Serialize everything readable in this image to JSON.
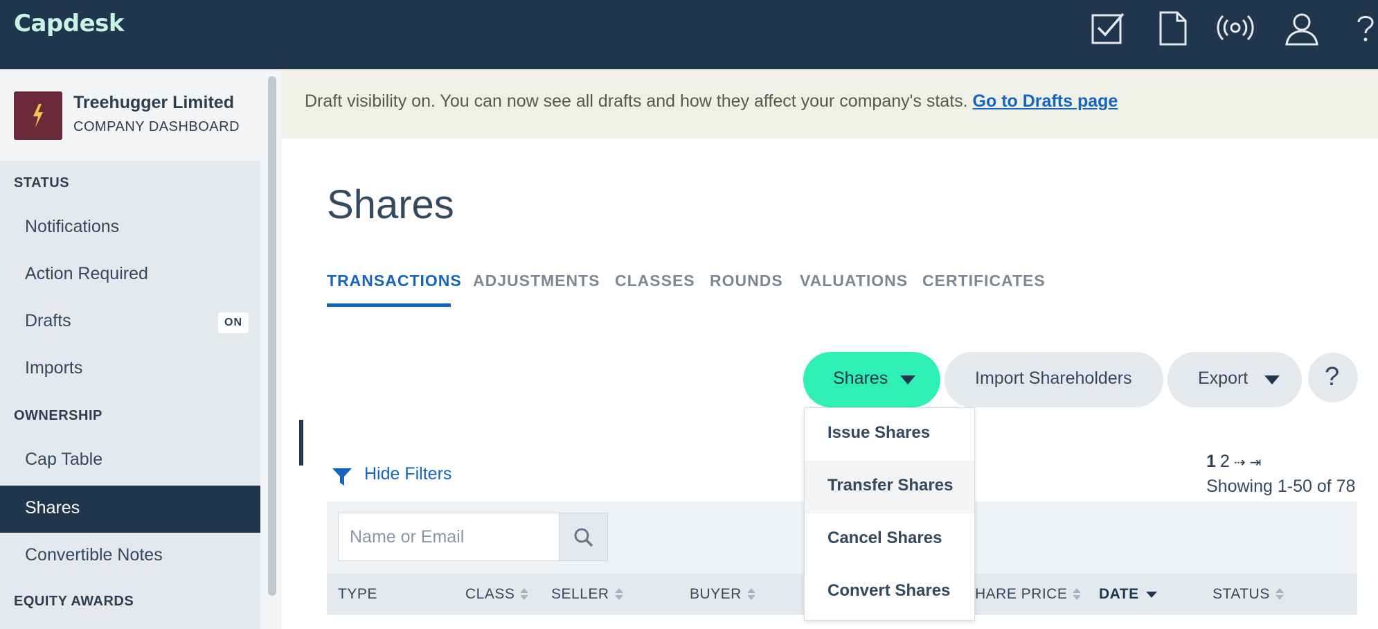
{
  "app": {
    "logo": "Capdesk"
  },
  "topbar": {
    "icons": [
      "tasks-icon",
      "document-icon",
      "broadcast-icon",
      "user-icon",
      "help-icon"
    ]
  },
  "company": {
    "name": "Treehugger Limited",
    "subtitle": "COMPANY DASHBOARD"
  },
  "sidebar": {
    "sections": [
      {
        "title": "STATUS",
        "items": [
          {
            "label": "Notifications"
          },
          {
            "label": "Action Required"
          },
          {
            "label": "Drafts",
            "badge": "ON"
          },
          {
            "label": "Imports"
          }
        ]
      },
      {
        "title": "OWNERSHIP",
        "items": [
          {
            "label": "Cap Table"
          },
          {
            "label": "Shares",
            "active": true
          },
          {
            "label": "Convertible Notes"
          }
        ]
      },
      {
        "title": "EQUITY AWARDS",
        "items": []
      }
    ]
  },
  "banner": {
    "text": "Draft visibility on. You can now see all drafts and how they affect your company's stats.",
    "link": "Go to Drafts page"
  },
  "page": {
    "title": "Shares"
  },
  "tabs": [
    {
      "label": "TRANSACTIONS",
      "active": true
    },
    {
      "label": "ADJUSTMENTS"
    },
    {
      "label": "CLASSES"
    },
    {
      "label": "ROUNDS"
    },
    {
      "label": "VALUATIONS"
    },
    {
      "label": "CERTIFICATES"
    }
  ],
  "actions": {
    "shares_label": "Shares",
    "import_label": "Import Shareholders",
    "export_label": "Export",
    "help_label": "?"
  },
  "shares_menu": [
    "Issue Shares",
    "Transfer Shares",
    "Cancel Shares",
    "Convert Shares"
  ],
  "filters": {
    "toggle_label": "Hide Filters",
    "search_placeholder": "Name or Email"
  },
  "pagination": {
    "current": "1",
    "next_page": "2",
    "next_symbol": "⇢",
    "last_symbol": "⇥",
    "summary": "Showing 1-50 of 78"
  },
  "table": {
    "columns": [
      "TYPE",
      "CLASS",
      "SELLER",
      "BUYER",
      "HARE PRICE",
      "DATE",
      "STATUS"
    ],
    "sorted_by": "DATE"
  },
  "colors": {
    "topbar": "#20364d",
    "accent": "#2ef0b4",
    "link": "#1565c0",
    "banner_bg": "#eff0e8",
    "sidebar_bg": "#e4e9ee"
  }
}
